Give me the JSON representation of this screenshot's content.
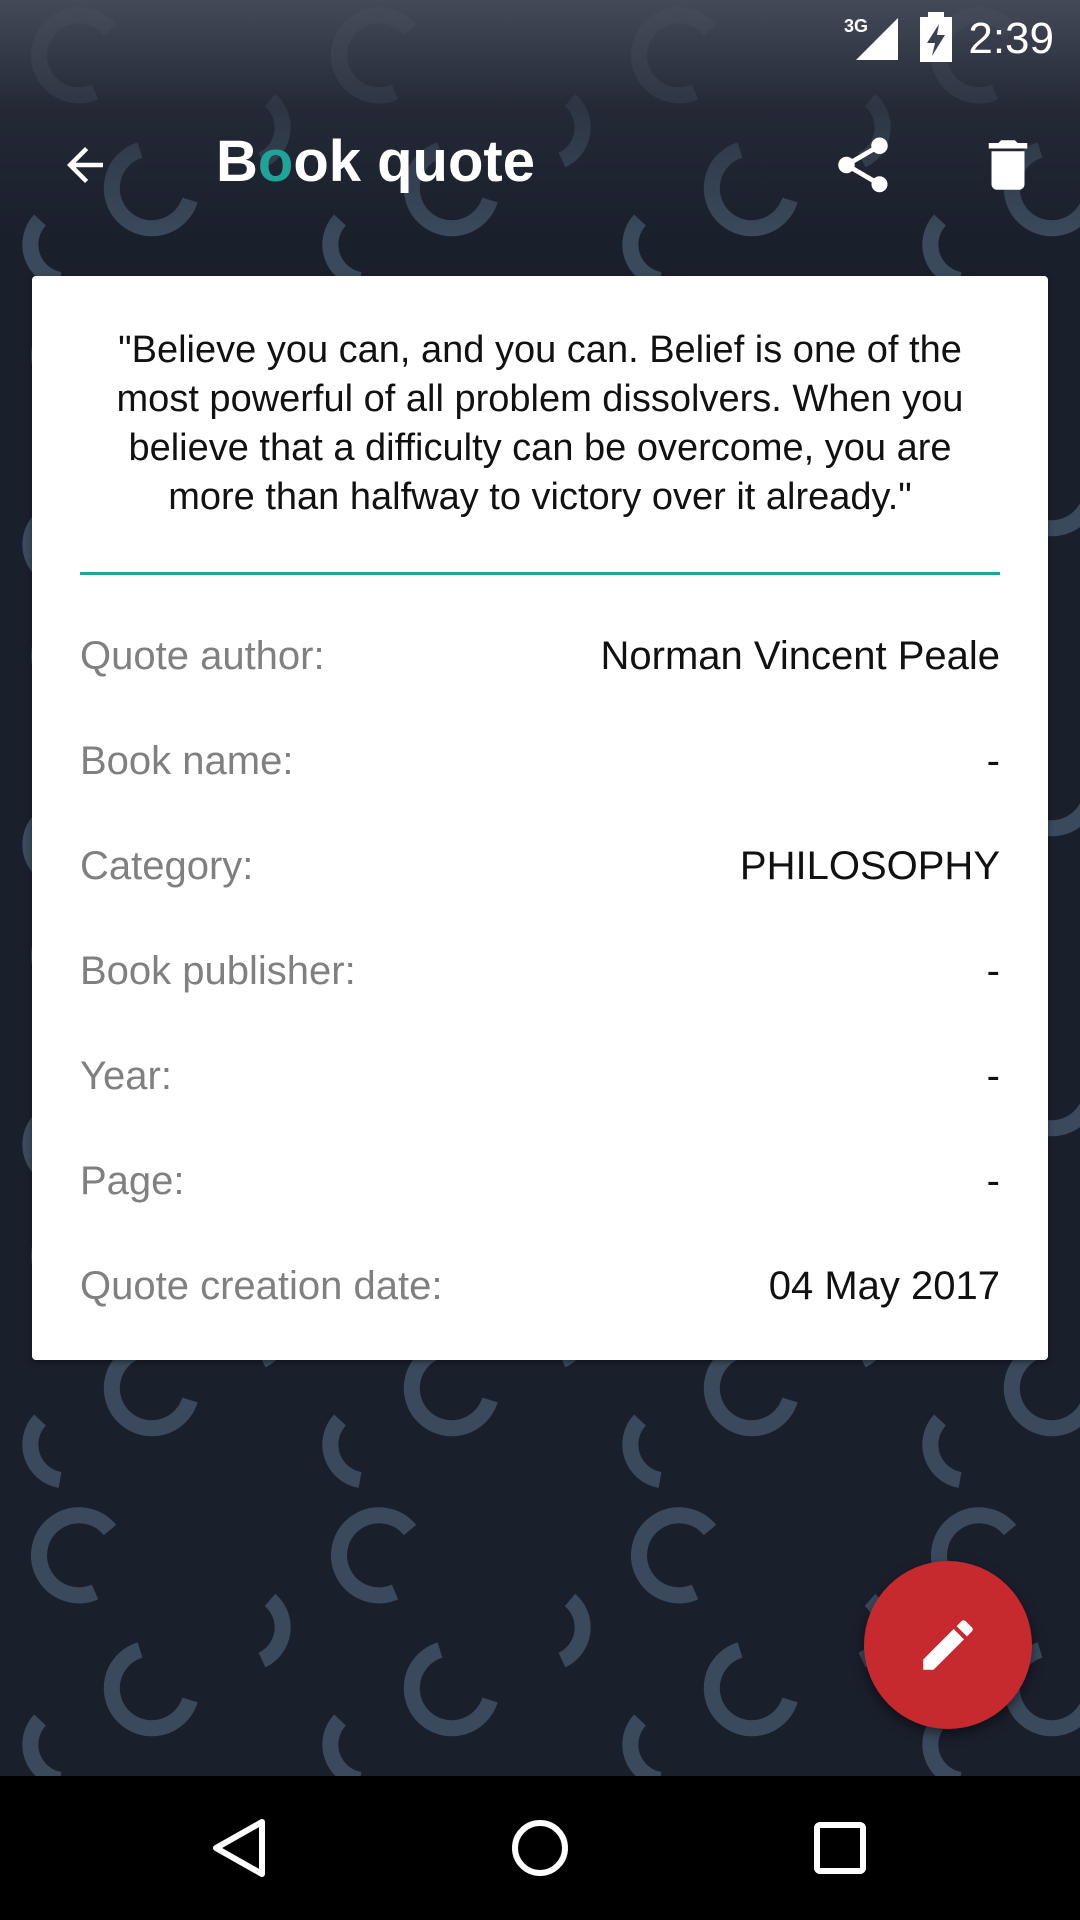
{
  "status_bar": {
    "time": "2:39",
    "network_label": "3G",
    "icons": [
      "signal-icon",
      "battery-charging-icon"
    ]
  },
  "app_bar": {
    "title_first": "B",
    "title_accent": "o",
    "title_rest": "ok quote",
    "icons": [
      "back-arrow-icon",
      "share-icon",
      "delete-icon"
    ]
  },
  "quote": {
    "text": "\"Believe you can, and you can. Belief is one of the most powerful of all problem dissolvers. When you believe that a difficulty can be overcome, you are more than halfway to victory over it already.\""
  },
  "details": [
    {
      "label": "Quote author:",
      "value": "Norman Vincent Peale"
    },
    {
      "label": "Book name:",
      "value": "-"
    },
    {
      "label": "Category:",
      "value": "PHILOSOPHY"
    },
    {
      "label": "Book publisher:",
      "value": "-"
    },
    {
      "label": "Year:",
      "value": "-"
    },
    {
      "label": "Page:",
      "value": "-"
    },
    {
      "label": "Quote creation date:",
      "value": "04 May 2017"
    }
  ],
  "fab": {
    "icon": "edit-pencil-icon"
  },
  "nav_bar": {
    "icons": [
      "nav-back-icon",
      "nav-home-icon",
      "nav-recents-icon"
    ]
  },
  "colors": {
    "background": "#1a1f2c",
    "pattern": "#3a4a5c",
    "accent": "#1fa598",
    "fab": "#c62a2f",
    "card": "#ffffff",
    "label": "#808080"
  }
}
